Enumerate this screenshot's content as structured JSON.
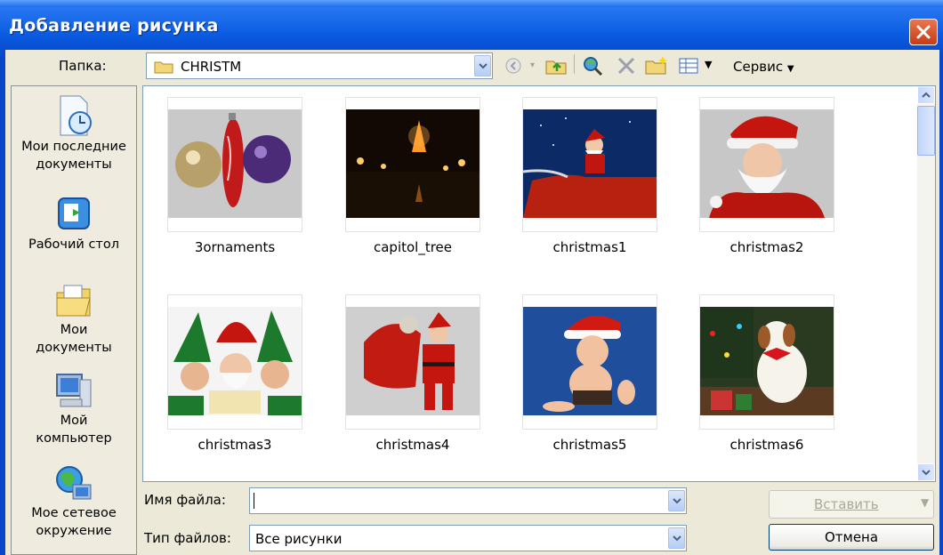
{
  "window": {
    "title": "Добавление рисунка"
  },
  "toolbar": {
    "folder_label": "Папка:",
    "folder_value": "CHRISTM",
    "tools_label": "Сервис"
  },
  "places": [
    {
      "label1": "Мои последние",
      "label2": "документы",
      "icon": "recent-documents-icon"
    },
    {
      "label1": "Рабочий стол",
      "label2": "",
      "icon": "desktop-icon"
    },
    {
      "label1": "Мои",
      "label2": "документы",
      "icon": "my-documents-icon"
    },
    {
      "label1": "Мой",
      "label2": "компьютер",
      "icon": "my-computer-icon"
    },
    {
      "label1": "Мое сетевое",
      "label2": "окружение",
      "icon": "network-places-icon"
    }
  ],
  "files": [
    {
      "name": "3ornaments"
    },
    {
      "name": "capitol_tree"
    },
    {
      "name": "christmas1"
    },
    {
      "name": "christmas2"
    },
    {
      "name": "christmas3"
    },
    {
      "name": "christmas4"
    },
    {
      "name": "christmas5"
    },
    {
      "name": "christmas6"
    }
  ],
  "bottom": {
    "filename_label": "Имя файла:",
    "filename_value": "",
    "filetype_label": "Тип файлов:",
    "filetype_value": "Все рисунки",
    "insert_label": "Вставить",
    "cancel_label": "Отмена"
  },
  "colors": {
    "titlebar": "#0a5be0",
    "face": "#ece9d8",
    "close": "#c73a17"
  }
}
